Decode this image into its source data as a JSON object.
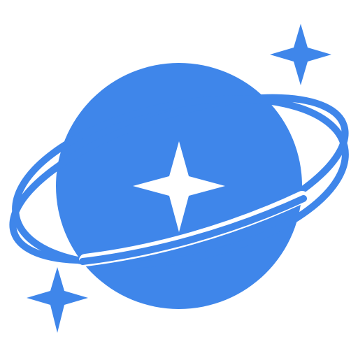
{
  "icon": {
    "name": "planet-orbits-stars-icon",
    "colors": {
      "brand": "#3F86EA",
      "background": "#FFFFFF",
      "accent_white": "#FFFFFF"
    }
  }
}
